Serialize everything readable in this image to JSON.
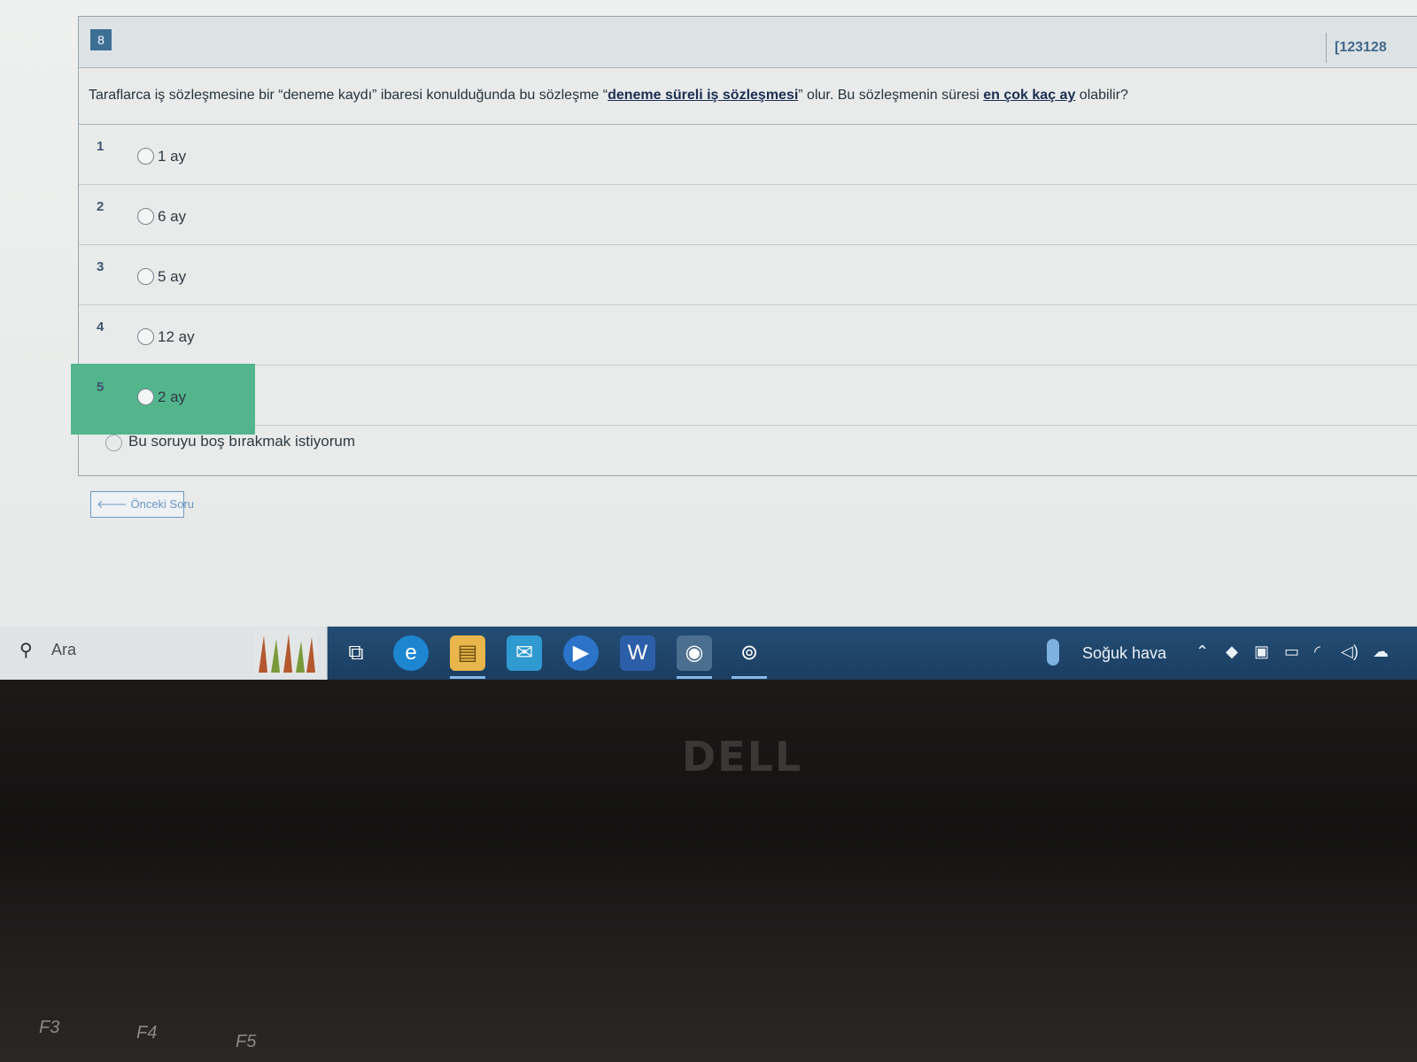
{
  "question": {
    "number": "8",
    "code": "[123128",
    "text_parts": [
      "Taraflarca iş sözleşmesine bir “deneme kaydı” ibaresi konulduğunda bu sözleşme “",
      "deneme süreli iş sözleşmesi",
      "” olur. Bu sözleşmenin süresi ",
      "en çok  kaç ay",
      " olabilir?"
    ]
  },
  "options": [
    {
      "num": "1",
      "label": "1 ay"
    },
    {
      "num": "2",
      "label": "6 ay"
    },
    {
      "num": "3",
      "label": "5 ay"
    },
    {
      "num": "4",
      "label": "12 ay"
    },
    {
      "num": "5",
      "label": "2 ay"
    }
  ],
  "highlight_color": "#53b58c",
  "blank_option": "Bu soruyu boş bırakmak istiyorum",
  "prev_button": "🡐 Önceki Soru",
  "taskbar": {
    "search_label": "Ara",
    "weather_label": "Soğuk hava",
    "pinned_icons": [
      "task-view-icon",
      "edge-icon",
      "file-explorer-icon",
      "mail-icon",
      "photos-icon",
      "word-icon",
      "chrome-icon",
      "app-icon"
    ]
  },
  "device": {
    "logo": "DELL",
    "keys": [
      "F3",
      "F4",
      "F5"
    ]
  }
}
